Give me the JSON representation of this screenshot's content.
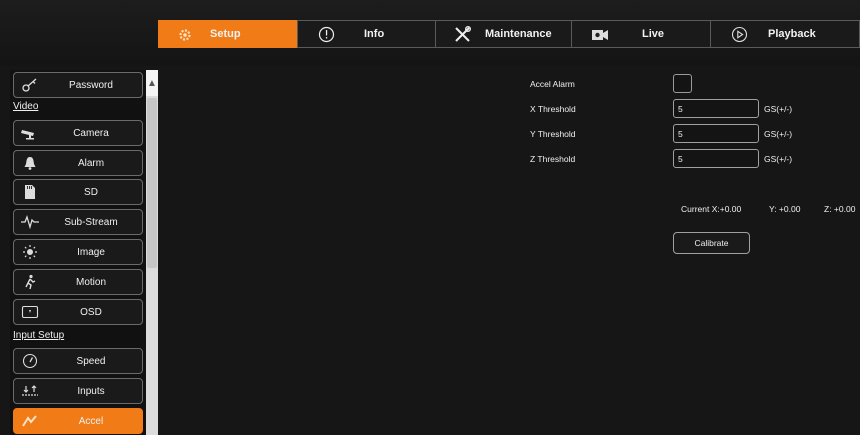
{
  "colors": {
    "accent": "#f07b17",
    "background": "#161616",
    "border": "#6a6a6a"
  },
  "nav": {
    "tabs": [
      {
        "label": "Setup",
        "icon": "gear-icon",
        "active": true
      },
      {
        "label": "Info",
        "icon": "info-circle-icon",
        "active": false
      },
      {
        "label": "Maintenance",
        "icon": "tools-icon",
        "active": false
      },
      {
        "label": "Live",
        "icon": "video-camera-icon",
        "active": false
      },
      {
        "label": "Playback",
        "icon": "play-circle-icon",
        "active": false
      }
    ]
  },
  "sidebar": {
    "items": [
      {
        "label": "Password",
        "icon": "key-icon"
      },
      {
        "section": "Video"
      },
      {
        "label": "Camera",
        "icon": "camera-icon"
      },
      {
        "label": "Alarm",
        "icon": "bell-icon"
      },
      {
        "label": "SD",
        "icon": "sd-card-icon"
      },
      {
        "label": "Sub-Stream",
        "icon": "waveform-icon"
      },
      {
        "label": "Image",
        "icon": "brightness-icon"
      },
      {
        "label": "Motion",
        "icon": "running-person-icon"
      },
      {
        "label": "OSD",
        "icon": "osd-icon"
      },
      {
        "section": "Input Setup"
      },
      {
        "label": "Speed",
        "icon": "speedometer-icon"
      },
      {
        "label": "Inputs",
        "icon": "inputs-icon"
      },
      {
        "label": "Accel",
        "icon": "accel-icon",
        "active": true
      }
    ]
  },
  "form": {
    "accel_alarm": {
      "label": "Accel Alarm",
      "checked": false
    },
    "x_threshold": {
      "label": "X Threshold",
      "value": "5",
      "unit": "GS(+/-)"
    },
    "y_threshold": {
      "label": "Y Threshold",
      "value": "5",
      "unit": "GS(+/-)"
    },
    "z_threshold": {
      "label": "Z Threshold",
      "value": "5",
      "unit": "GS(+/-)"
    },
    "readout": {
      "x": "Current X:+0.00",
      "y": "Y: +0.00",
      "z": "Z: +0.00"
    },
    "calibrate_label": "Calibrate"
  }
}
